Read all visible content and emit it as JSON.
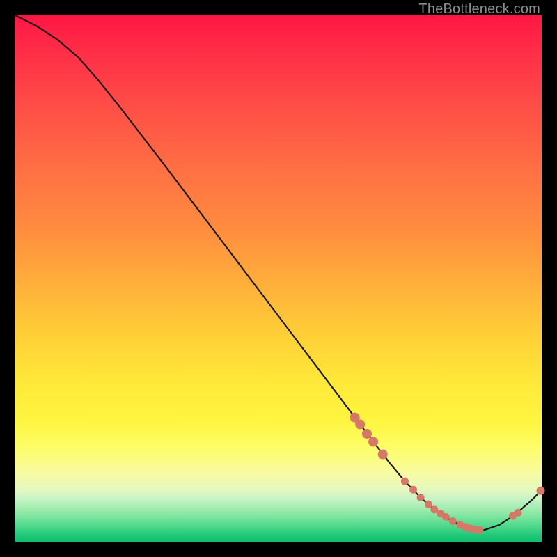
{
  "watermark": "TheBottleneck.com",
  "colors": {
    "dot": "#d77768",
    "line": "#1a1a1a"
  },
  "chart_data": {
    "type": "line",
    "title": "",
    "xlabel": "",
    "ylabel": "",
    "xlim": [
      0,
      100
    ],
    "ylim": [
      0,
      100
    ],
    "grid": false,
    "series": [
      {
        "name": "bottleneck-curve",
        "x": [
          0,
          4,
          8,
          12,
          16,
          20,
          24,
          28,
          32,
          36,
          40,
          44,
          48,
          52,
          56,
          60,
          64,
          68,
          71,
          74,
          77,
          80,
          83,
          86,
          89,
          92,
          95,
          98,
          100
        ],
        "y": [
          100,
          98.0,
          95.4,
          92.0,
          87.4,
          82.4,
          77.2,
          72.0,
          66.7,
          61.4,
          56.1,
          50.8,
          45.5,
          40.2,
          34.9,
          29.6,
          24.3,
          19.0,
          15.1,
          11.5,
          8.4,
          5.8,
          3.9,
          2.6,
          2.2,
          3.2,
          5.2,
          7.8,
          9.8
        ]
      }
    ],
    "markers": {
      "name": "highlight-points",
      "x": [
        64.5,
        65.5,
        66.8,
        68.0,
        69.8,
        74.0,
        75.6,
        77.0,
        78.5,
        79.6,
        80.8,
        81.8,
        83.1,
        84.5,
        85.5,
        86.5,
        87.4,
        88.2,
        94.5,
        95.5,
        99.8
      ],
      "y": [
        23.6,
        22.3,
        20.5,
        19.0,
        16.6,
        11.5,
        9.9,
        8.4,
        7.1,
        6.1,
        5.3,
        4.7,
        3.9,
        3.2,
        2.8,
        2.5,
        2.3,
        2.2,
        4.9,
        5.5,
        9.7
      ],
      "r": [
        7,
        7,
        7,
        7,
        7,
        5.5,
        5.5,
        5.5,
        5.5,
        5.5,
        5.5,
        5.5,
        5.5,
        5.5,
        5.5,
        5.5,
        5.5,
        5.5,
        5.5,
        5.5,
        6
      ]
    }
  }
}
